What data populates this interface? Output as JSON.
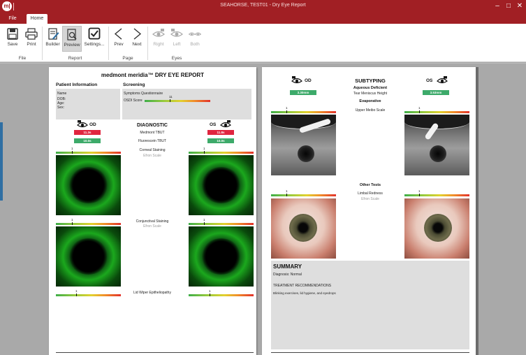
{
  "window": {
    "title": "SEAHORSE, TEST01 - Dry Eye Report",
    "logo": "m|",
    "minimize_icon": "minimize-icon",
    "maximize_icon": "maximize-icon",
    "close_icon": "close-icon"
  },
  "tabs": [
    {
      "label": "File"
    },
    {
      "label": "Home"
    }
  ],
  "ribbon": {
    "file_group": {
      "label": "File",
      "buttons": [
        {
          "label": "Save",
          "icon": "save-icon"
        },
        {
          "label": "Print",
          "icon": "print-icon"
        }
      ]
    },
    "report_group": {
      "label": "Report",
      "buttons": [
        {
          "label": "Builder",
          "icon": "builder-icon"
        },
        {
          "label": "Preview",
          "icon": "preview-icon"
        },
        {
          "label": "Settings...",
          "icon": "settings-check-icon"
        }
      ]
    },
    "page_group": {
      "label": "Page",
      "buttons": [
        {
          "label": "Prev",
          "icon": "prev-icon"
        },
        {
          "label": "Next",
          "icon": "next-icon"
        }
      ]
    },
    "eyes_group": {
      "label": "Eyes",
      "buttons": [
        {
          "label": "Right",
          "icon": "right-eye-icon"
        },
        {
          "label": "Left",
          "icon": "left-eye-icon"
        },
        {
          "label": "Both",
          "icon": "both-eyes-icon"
        }
      ]
    }
  },
  "page1": {
    "title": "medmont meridia™ DRY EYE REPORT",
    "patient_info_heading": "Patient Information",
    "patient_fields": [
      "Name",
      "DOB:",
      "Age:",
      "Sex:"
    ],
    "screening_heading": "Screening",
    "symptoms_label": "Symptoms Questionnaire",
    "osdi_label": "OSDI Score",
    "osdi_value": "11",
    "diagnostic_heading": "DIAGNOSTIC",
    "od_label": "OD",
    "os_label": "OS",
    "rows": [
      {
        "label": "Medmont TBUT",
        "od": "11.3s",
        "os": "11.8s",
        "od_color": "red",
        "os_color": "red"
      },
      {
        "label": "Fluorescein TBUT",
        "od": "10.0s",
        "os": "10.0s",
        "od_color": "green",
        "os_color": "green"
      }
    ],
    "corneal_label": "Corneal Staining",
    "corneal_scale": "Efron Scale",
    "corneal_od_grade": "1",
    "corneal_os_grade": "1",
    "conjunctival_label": "Conjunctival Staining",
    "conjunctival_scale": "Efron Scale",
    "conjunctival_od_grade": "1",
    "conjunctival_os_grade": "1",
    "lid_wiper_label": "Lid Wiper Epitheliopathy",
    "lid_wiper_od_grade": "1",
    "lid_wiper_os_grade": "1"
  },
  "page2": {
    "subtyping_heading": "SUBTYPING",
    "od_label": "OD",
    "os_label": "OS",
    "aqueous_label": "Aqueous Deficient",
    "tear_meniscus_label": "Tear Meniscus Height",
    "od_tmh": "3.30mm",
    "os_tmh": "3.53mm",
    "evaporative_label": "Evaporative",
    "upper_meibo_label": "Upper Meibo Scale",
    "meibo_od_grade": "1",
    "meibo_os_grade": "1",
    "other_tests_label": "Other Tests",
    "limbal_label": "Limbal Redness",
    "limbal_scale": "Efron Scale",
    "limbal_od_grade": "1",
    "limbal_os_grade": "1",
    "summary_heading": "SUMMARY",
    "diagnosis": "Diagnosis: Normal",
    "treatment_heading": "TREATMENT RECOMMENDATIONS",
    "treatment_text": "Blinking exercises, lid hygiene, and eyedrops"
  },
  "colors": {
    "titlebar": "#a11f24",
    "pill_red": "#e0253f",
    "pill_green": "#3daa6a",
    "sidebar_tab": "#2f6fa3"
  }
}
